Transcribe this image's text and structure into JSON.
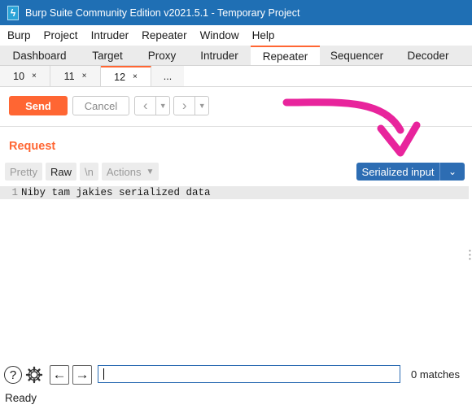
{
  "window": {
    "title": "Burp Suite Community Edition v2021.5.1 - Temporary Project"
  },
  "menu": [
    "Burp",
    "Project",
    "Intruder",
    "Repeater",
    "Window",
    "Help"
  ],
  "tabs": [
    {
      "label": "Dashboard",
      "active": false
    },
    {
      "label": "Target",
      "active": false
    },
    {
      "label": "Proxy",
      "active": false
    },
    {
      "label": "Intruder",
      "active": false
    },
    {
      "label": "Repeater",
      "active": true
    },
    {
      "label": "Sequencer",
      "active": false
    },
    {
      "label": "Decoder",
      "active": false
    }
  ],
  "subtabs": [
    {
      "label": "10",
      "close": "×",
      "active": false
    },
    {
      "label": "11",
      "close": "×",
      "active": false
    },
    {
      "label": "12",
      "close": "×",
      "active": true
    }
  ],
  "subtabs_more": "...",
  "toolbar": {
    "send_label": "Send",
    "cancel_label": "Cancel",
    "back_icon": "chevron-left-icon",
    "forward_icon": "chevron-right-icon"
  },
  "request": {
    "label": "Request",
    "pretty_label": "Pretty",
    "raw_label": "Raw",
    "newline_label": "\\n",
    "actions_label": "Actions",
    "serialized_label": "Serialized input",
    "line_number": "1",
    "line_text": "Niby tam jakies serialized data"
  },
  "search": {
    "value": "",
    "matches_text": "0 matches"
  },
  "status": {
    "text": "Ready"
  },
  "colors": {
    "titlebar": "#1f6fb4",
    "accent": "#ff6633",
    "serialized_button": "#2d6db3",
    "annotation_arrow": "#e8249c"
  }
}
